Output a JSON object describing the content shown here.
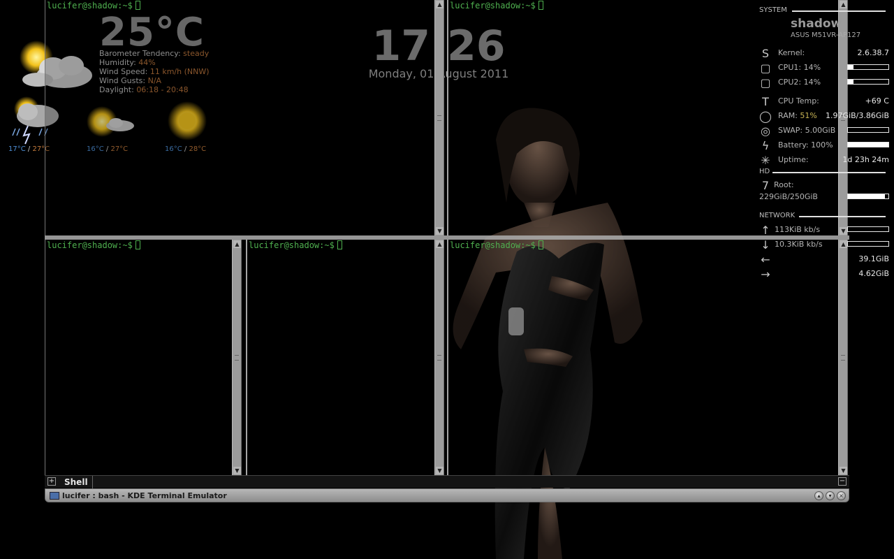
{
  "weather": {
    "current_temp": "25°C",
    "details": [
      {
        "label": "Barometer Tendency:",
        "value": "steady"
      },
      {
        "label": "Humidity:",
        "value": "44%"
      },
      {
        "label": "Wind Speed:",
        "value": "11 km/h (NNW)"
      },
      {
        "label": "Wind Gusts:",
        "value": "N/A"
      },
      {
        "label": "Daylight:",
        "value": "06:18 - 20:48"
      }
    ],
    "forecast": [
      {
        "icon": "thunderstorm-icon",
        "low": "17°C",
        "sep": " / ",
        "high": "27°C"
      },
      {
        "icon": "sun-cloud-icon",
        "low": "16°C",
        "sep": " / ",
        "high": "27°C"
      },
      {
        "icon": "sun-icon",
        "low": "16°C",
        "sep": " / ",
        "high": "28°C"
      }
    ],
    "colors": {
      "low": "#4e8fd6",
      "high": "#c27a3c"
    }
  },
  "clock": {
    "time": "17:26",
    "date": "Monday, 01 August 2011"
  },
  "terminal": {
    "prompt": "lucifer@shadow:~$",
    "tab_label": "Shell",
    "window_title": "lucifer : bash - KDE Terminal Emulator",
    "prompt_color": "#4fb04f"
  },
  "conky": {
    "system_header": "SYSTEM",
    "hostname": "shadow",
    "model": "ASUS M51VR-AP127",
    "kernel": {
      "label": "Kernel:",
      "value": "2.6.38.7"
    },
    "cpu1": {
      "label": "CPU1: 14%",
      "percent": 14
    },
    "cpu2": {
      "label": "CPU2: 14%",
      "percent": 14
    },
    "cpu_temp": {
      "label": "CPU Temp:",
      "value": "+69 C"
    },
    "ram": {
      "label": "RAM:",
      "percent_text": "51%",
      "value": "1.97GiB/3.86GiB"
    },
    "swap": {
      "label": "SWAP: 5.00GiB",
      "percent": 0
    },
    "battery": {
      "label": "Battery: 100%",
      "percent": 100
    },
    "uptime": {
      "label": "Uptime:",
      "value": "1d 23h 24m"
    },
    "hd_header": "HD",
    "root": {
      "label": "Root:",
      "value": "229GiB/250GiB",
      "percent": 92
    },
    "network_header": "NETWORK",
    "up_speed": "113KiB kb/s",
    "down_speed": "10.3KiB kb/s",
    "total_down": "39.1GiB",
    "total_up": "4.62GiB"
  }
}
